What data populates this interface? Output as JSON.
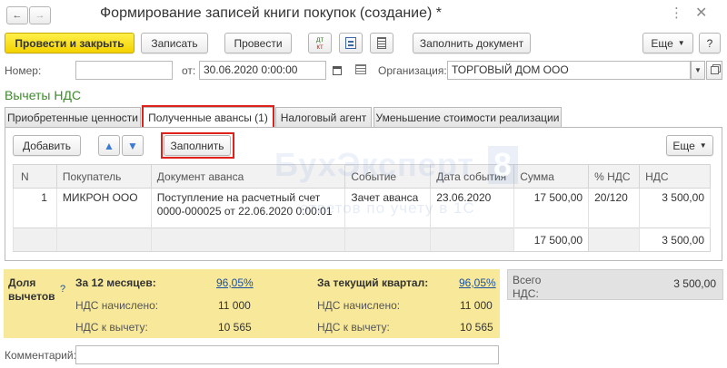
{
  "window": {
    "title": "Формирование записей книги покупок (создание) *"
  },
  "toolbar": {
    "post_and_close": "Провести и закрыть",
    "save": "Записать",
    "post": "Провести",
    "dt_kt": "Дт/Кт",
    "fill_document": "Заполнить документ",
    "more": "Еще"
  },
  "header": {
    "number_label": "Номер:",
    "number_value": "",
    "date_label": "от:",
    "date_value": "30.06.2020  0:00:00",
    "org_label": "Организация:",
    "org_value": "ТОРГОВЫЙ ДОМ ООО"
  },
  "section": {
    "title": "Вычеты НДС"
  },
  "tabs": [
    {
      "label": "Приобретенные ценности"
    },
    {
      "label": "Полученные авансы (1)"
    },
    {
      "label": "Налоговый агент"
    },
    {
      "label": "Уменьшение стоимости реализации"
    }
  ],
  "table_toolbar": {
    "add": "Добавить",
    "fill": "Заполнить",
    "more": "Еще"
  },
  "watermark": {
    "brand": "БухЭксперт",
    "brand_num": "8",
    "tagline": "ответов по учету в 1С"
  },
  "table": {
    "columns": [
      "N",
      "Покупатель",
      "Документ аванса",
      "Событие",
      "Дата события",
      "Сумма",
      "% НДС",
      "НДС"
    ],
    "rows": [
      {
        "n": "1",
        "buyer": "МИКРОН ООО",
        "doc_line1": "Поступление на расчетный счет",
        "doc_line2": "0000-000025 от 22.06.2020 0:00:01",
        "event": "Зачет аванса",
        "event_date": "23.06.2020",
        "sum": "17 500,00",
        "vat_rate": "20/120",
        "vat": "3 500,00"
      }
    ],
    "totals": {
      "sum": "17 500,00",
      "vat": "3 500,00"
    }
  },
  "summary": {
    "share_label_1": "Доля",
    "share_label_2": "вычетов",
    "help": "?",
    "year_title": "За 12 месяцев:",
    "year_pct": "96,05%",
    "quarter_title": "За текущий квартал:",
    "quarter_pct": "96,05%",
    "accrued_label": "НДС начислено:",
    "deductible_label": "НДС к вычету:",
    "year_accrued": "11 000",
    "year_deductible": "10 565",
    "quarter_accrued": "11 000",
    "quarter_deductible": "10 565",
    "total_label_1": "Всего",
    "total_label_2": "НДС:",
    "total_value": "3 500,00"
  },
  "footer": {
    "comment_label": "Комментарий:",
    "comment_value": ""
  }
}
